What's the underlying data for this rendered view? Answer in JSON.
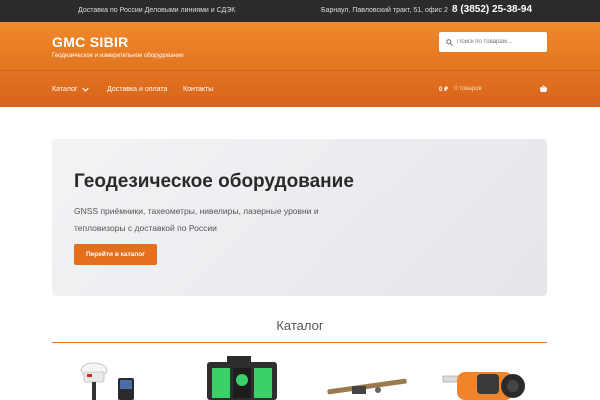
{
  "topbar": {
    "delivery_text": "Доставка по России Деловыми линиями и СДЭК",
    "address": "Барнаул, Павловский тракт, 51, офис 2",
    "phone": "8 (3852) 25-38-94"
  },
  "header": {
    "brand": "GMC SIBIR",
    "tagline": "Геодезическое и измерительное оборудование",
    "search_placeholder": "Поиск по товарам…"
  },
  "nav": {
    "items": [
      {
        "label": "Каталог"
      },
      {
        "label": "Доставка и оплата"
      },
      {
        "label": "Контакты"
      }
    ]
  },
  "cart": {
    "price": "0 ₽",
    "count": "0 товаров"
  },
  "hero": {
    "title": "Геодезическое оборудование",
    "subtitle": "GNSS приёмники, тахеометры, нивелиры, лазерные уровни и тепловизоры с доставкой по России",
    "button_label": "Перейти в каталог"
  },
  "catalog": {
    "title": "Каталог"
  },
  "colors": {
    "accent": "#e4701f",
    "header_top": "#f08a2a",
    "header_bottom": "#d9631a",
    "topbar": "#2b2b2b"
  },
  "icons": [
    "search-icon",
    "chevron-down-icon",
    "basket-icon"
  ]
}
